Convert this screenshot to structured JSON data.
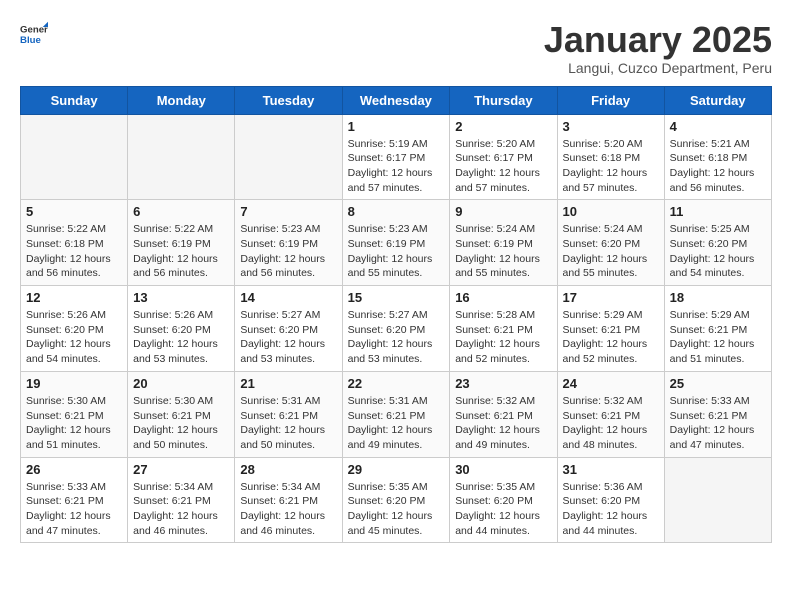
{
  "header": {
    "logo_general": "General",
    "logo_blue": "Blue",
    "title": "January 2025",
    "subtitle": "Langui, Cuzco Department, Peru"
  },
  "weekdays": [
    "Sunday",
    "Monday",
    "Tuesday",
    "Wednesday",
    "Thursday",
    "Friday",
    "Saturday"
  ],
  "weeks": [
    [
      {
        "num": "",
        "info": ""
      },
      {
        "num": "",
        "info": ""
      },
      {
        "num": "",
        "info": ""
      },
      {
        "num": "1",
        "info": "Sunrise: 5:19 AM\nSunset: 6:17 PM\nDaylight: 12 hours and 57 minutes."
      },
      {
        "num": "2",
        "info": "Sunrise: 5:20 AM\nSunset: 6:17 PM\nDaylight: 12 hours and 57 minutes."
      },
      {
        "num": "3",
        "info": "Sunrise: 5:20 AM\nSunset: 6:18 PM\nDaylight: 12 hours and 57 minutes."
      },
      {
        "num": "4",
        "info": "Sunrise: 5:21 AM\nSunset: 6:18 PM\nDaylight: 12 hours and 56 minutes."
      }
    ],
    [
      {
        "num": "5",
        "info": "Sunrise: 5:22 AM\nSunset: 6:18 PM\nDaylight: 12 hours and 56 minutes."
      },
      {
        "num": "6",
        "info": "Sunrise: 5:22 AM\nSunset: 6:19 PM\nDaylight: 12 hours and 56 minutes."
      },
      {
        "num": "7",
        "info": "Sunrise: 5:23 AM\nSunset: 6:19 PM\nDaylight: 12 hours and 56 minutes."
      },
      {
        "num": "8",
        "info": "Sunrise: 5:23 AM\nSunset: 6:19 PM\nDaylight: 12 hours and 55 minutes."
      },
      {
        "num": "9",
        "info": "Sunrise: 5:24 AM\nSunset: 6:19 PM\nDaylight: 12 hours and 55 minutes."
      },
      {
        "num": "10",
        "info": "Sunrise: 5:24 AM\nSunset: 6:20 PM\nDaylight: 12 hours and 55 minutes."
      },
      {
        "num": "11",
        "info": "Sunrise: 5:25 AM\nSunset: 6:20 PM\nDaylight: 12 hours and 54 minutes."
      }
    ],
    [
      {
        "num": "12",
        "info": "Sunrise: 5:26 AM\nSunset: 6:20 PM\nDaylight: 12 hours and 54 minutes."
      },
      {
        "num": "13",
        "info": "Sunrise: 5:26 AM\nSunset: 6:20 PM\nDaylight: 12 hours and 53 minutes."
      },
      {
        "num": "14",
        "info": "Sunrise: 5:27 AM\nSunset: 6:20 PM\nDaylight: 12 hours and 53 minutes."
      },
      {
        "num": "15",
        "info": "Sunrise: 5:27 AM\nSunset: 6:20 PM\nDaylight: 12 hours and 53 minutes."
      },
      {
        "num": "16",
        "info": "Sunrise: 5:28 AM\nSunset: 6:21 PM\nDaylight: 12 hours and 52 minutes."
      },
      {
        "num": "17",
        "info": "Sunrise: 5:29 AM\nSunset: 6:21 PM\nDaylight: 12 hours and 52 minutes."
      },
      {
        "num": "18",
        "info": "Sunrise: 5:29 AM\nSunset: 6:21 PM\nDaylight: 12 hours and 51 minutes."
      }
    ],
    [
      {
        "num": "19",
        "info": "Sunrise: 5:30 AM\nSunset: 6:21 PM\nDaylight: 12 hours and 51 minutes."
      },
      {
        "num": "20",
        "info": "Sunrise: 5:30 AM\nSunset: 6:21 PM\nDaylight: 12 hours and 50 minutes."
      },
      {
        "num": "21",
        "info": "Sunrise: 5:31 AM\nSunset: 6:21 PM\nDaylight: 12 hours and 50 minutes."
      },
      {
        "num": "22",
        "info": "Sunrise: 5:31 AM\nSunset: 6:21 PM\nDaylight: 12 hours and 49 minutes."
      },
      {
        "num": "23",
        "info": "Sunrise: 5:32 AM\nSunset: 6:21 PM\nDaylight: 12 hours and 49 minutes."
      },
      {
        "num": "24",
        "info": "Sunrise: 5:32 AM\nSunset: 6:21 PM\nDaylight: 12 hours and 48 minutes."
      },
      {
        "num": "25",
        "info": "Sunrise: 5:33 AM\nSunset: 6:21 PM\nDaylight: 12 hours and 47 minutes."
      }
    ],
    [
      {
        "num": "26",
        "info": "Sunrise: 5:33 AM\nSunset: 6:21 PM\nDaylight: 12 hours and 47 minutes."
      },
      {
        "num": "27",
        "info": "Sunrise: 5:34 AM\nSunset: 6:21 PM\nDaylight: 12 hours and 46 minutes."
      },
      {
        "num": "28",
        "info": "Sunrise: 5:34 AM\nSunset: 6:21 PM\nDaylight: 12 hours and 46 minutes."
      },
      {
        "num": "29",
        "info": "Sunrise: 5:35 AM\nSunset: 6:20 PM\nDaylight: 12 hours and 45 minutes."
      },
      {
        "num": "30",
        "info": "Sunrise: 5:35 AM\nSunset: 6:20 PM\nDaylight: 12 hours and 44 minutes."
      },
      {
        "num": "31",
        "info": "Sunrise: 5:36 AM\nSunset: 6:20 PM\nDaylight: 12 hours and 44 minutes."
      },
      {
        "num": "",
        "info": ""
      }
    ]
  ]
}
